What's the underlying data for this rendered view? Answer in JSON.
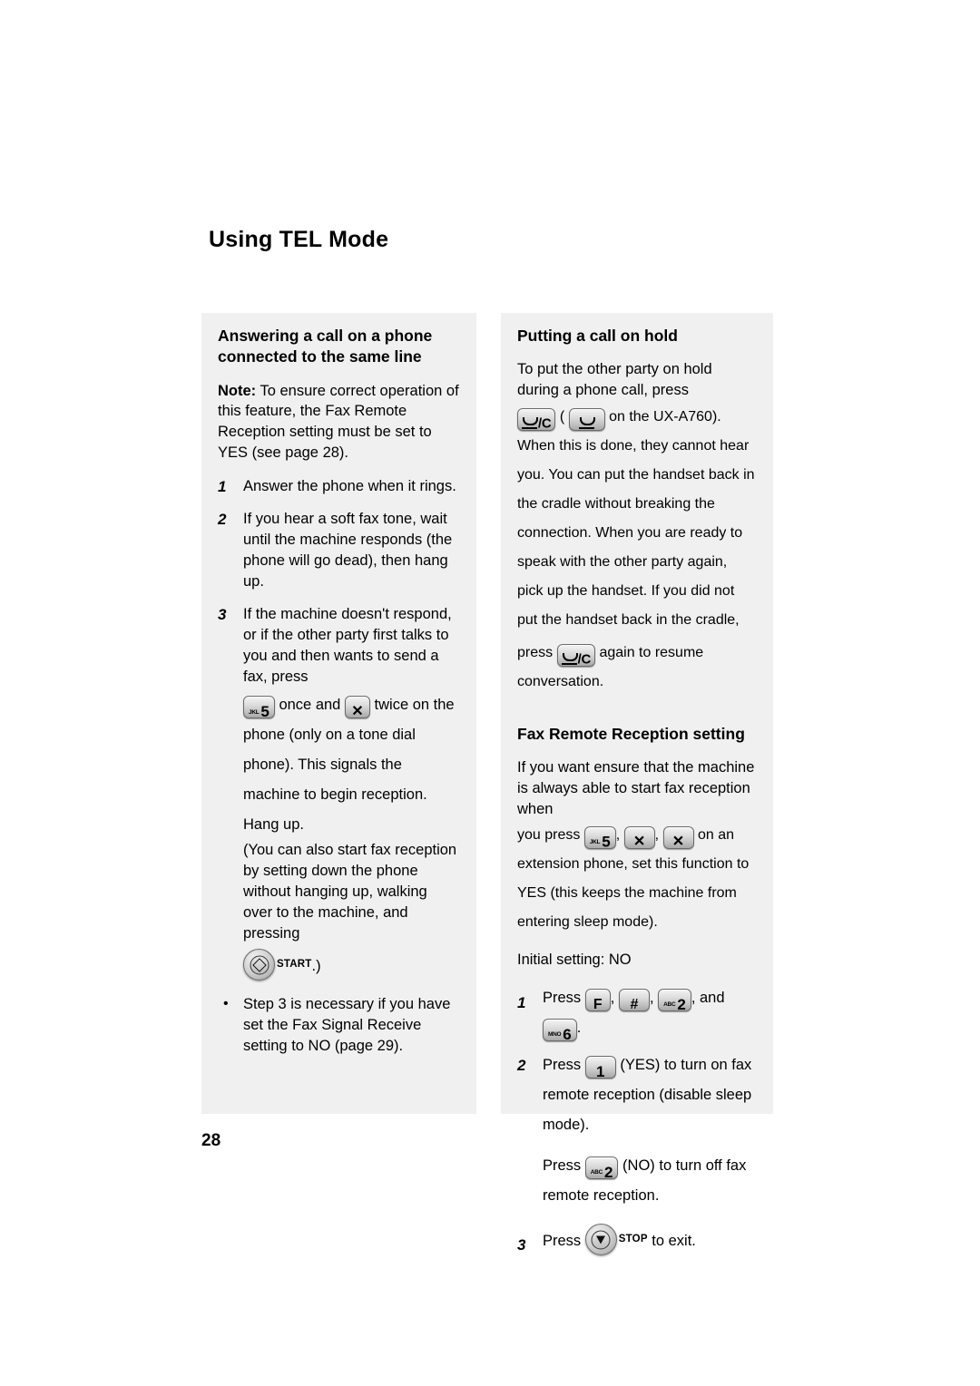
{
  "page": {
    "title": "Using TEL Mode",
    "number": "28",
    "panel_bg": "#f0f0f0"
  },
  "left_column": {
    "heading": "Answering a call on a phone connected to the same line",
    "note": {
      "label": "Note:",
      "text": " To ensure correct operation of this feature, the Fax Remote Reception setting must be set to YES (see page 28)."
    },
    "steps": [
      {
        "num": "1",
        "text": "Answer the phone when it rings."
      },
      {
        "num": "2",
        "text": "If you hear a soft fax tone, wait until the machine responds (the phone will go dead), then hang up."
      },
      {
        "num": "3",
        "text_before_keys": "If the machine doesn't respond, or if the other party first talks to you and then wants to send a fax, press",
        "key_5": {
          "letters": "JKL",
          "digit": "5"
        },
        "text_mid": "once and",
        "key_star": {
          "sym": "✕"
        },
        "text_after": "twice on the phone (only on a tone dial phone). This signals the machine to begin reception. Hang up.",
        "paren_text": "(You can also start fax reception by setting down the phone without hanging up, walking over to the machine, and pressing",
        "start_button_label": "START",
        "paren_close": ".)"
      }
    ],
    "bullet": {
      "marker": "•",
      "text": "Step 3 is necessary if you have set the Fax Signal Receive setting to NO (page 29)."
    }
  },
  "right_column": {
    "hold_section": {
      "heading": "Putting a call on hold",
      "text_1": "To put the other party on hold during a phone call, press",
      "hold_key_label": "/C",
      "paren_open": "(",
      "text_2": "on the UX-A760). When this is done, they cannot hear you. You can put the handset back in the cradle without breaking the connection. When you are ready to speak with the other party again, pick up the handset. If you did not put the handset back in the cradle,",
      "text_3": "press",
      "text_4": "again to resume conversation."
    },
    "remote_section": {
      "heading": "Fax Remote Reception setting",
      "intro": "If you want ensure that the machine is always able to start fax reception when",
      "press_label": "you press",
      "key_5": {
        "letters": "JKL",
        "digit": "5"
      },
      "key_star": {
        "sym": "✕"
      },
      "comma": ",",
      "after_keys": "on an extension phone, set this function to YES (this keeps the machine from entering sleep mode).",
      "initial_setting": "Initial setting: NO",
      "steps": [
        {
          "num": "1",
          "press": "Press",
          "key_f": {
            "sym": "F"
          },
          "key_hash": {
            "sym": "#"
          },
          "key_2": {
            "letters": "ABC",
            "digit": "2"
          },
          "and": ", and",
          "key_6": {
            "letters": "MNO",
            "digit": "6"
          },
          "period": "."
        },
        {
          "num": "2",
          "press": "Press",
          "key_1": {
            "digit": "1"
          },
          "text": "(YES) to turn on fax remote reception (disable sleep mode).",
          "sub_press": "Press",
          "key_2": {
            "letters": "ABC",
            "digit": "2"
          },
          "sub_text": "(NO) to turn off fax remote reception."
        },
        {
          "num": "3",
          "press": "Press",
          "stop_button_label": "STOP",
          "text": "to exit."
        }
      ]
    }
  }
}
